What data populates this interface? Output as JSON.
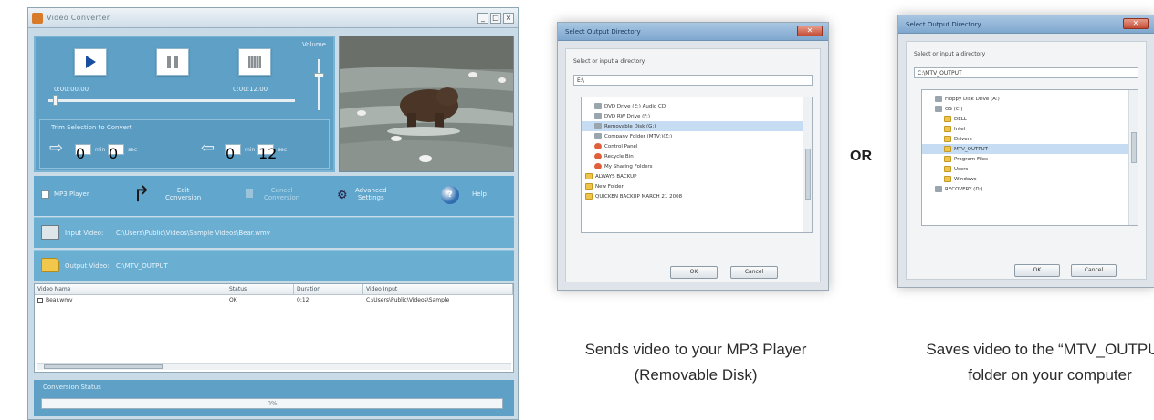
{
  "main_window": {
    "title": "Video Converter",
    "titlebar_buttons": [
      "_",
      "□",
      "×"
    ],
    "player": {
      "elapsed": "0:00:00.00",
      "duration": "0:00:12.00",
      "volume_label": "Volume",
      "volume_level": 0.7,
      "seek_position": 0.02,
      "trim_title": "Trim Selection to Convert",
      "trim_start": {
        "min": "0",
        "min_unit": "min",
        "sec": "0",
        "sec_unit": "sec"
      },
      "trim_end": {
        "min": "0",
        "min_unit": "min",
        "sec": "12",
        "sec_unit": "sec"
      }
    },
    "options": {
      "mp3_player_label": "MP3 Player",
      "edit_label": "Edit\nConversion",
      "cancel_label": "Cancel\nConversion",
      "settings_label": "Advanced\nSettings",
      "help_glyph": "?",
      "help_label": "Help"
    },
    "input_video": {
      "label": "Input Video:",
      "path": "C:\\Users\\Public\\Videos\\Sample Videos\\Bear.wmv"
    },
    "output_video": {
      "label": "Output Video:",
      "path": "C:\\MTV_OUTPUT"
    },
    "table": {
      "columns": [
        "Video Name",
        "Status",
        "Duration",
        "Video Input"
      ],
      "rows": [
        {
          "name": "Bear.wmv",
          "status": "OK",
          "duration": "0:12",
          "input": "C:\\Users\\Public\\Videos\\Sample"
        }
      ]
    },
    "status": {
      "label": "Conversion Status",
      "progress_text": "0%"
    }
  },
  "dialog_1": {
    "title": "Select Output Directory",
    "prompt": "Select or input a directory",
    "path_value": "E:\\",
    "tree": [
      {
        "label": "DVD Drive (E:) Audio CD",
        "icon": "drive",
        "indent": 1
      },
      {
        "label": "DVD RW Drive (F:)",
        "icon": "drive",
        "indent": 1
      },
      {
        "label": "Removable Disk (G:)",
        "icon": "drive",
        "indent": 1,
        "selected": true
      },
      {
        "label": "Company Folder (MTV:)(Z:)",
        "icon": "drive",
        "indent": 1
      },
      {
        "label": "Control Panel",
        "icon": "special",
        "indent": 1
      },
      {
        "label": "Recycle Bin",
        "icon": "special",
        "indent": 1
      },
      {
        "label": "My Sharing Folders",
        "icon": "special",
        "indent": 1
      },
      {
        "label": "ALWAYS BACKUP",
        "icon": "folder",
        "indent": 0
      },
      {
        "label": "New Folder",
        "icon": "folder",
        "indent": 0
      },
      {
        "label": "QUICKEN BACKUP MARCH 21 2008",
        "icon": "folder",
        "indent": 0
      }
    ],
    "ok_label": "OK",
    "cancel_label": "Cancel"
  },
  "dialog_2": {
    "title": "Select Output Directory",
    "prompt": "Select or input a directory",
    "path_value": "C:\\MTV_OUTPUT",
    "tree": [
      {
        "label": "Floppy Disk Drive (A:)",
        "icon": "drive",
        "indent": 1
      },
      {
        "label": "OS (C:)",
        "icon": "drive",
        "indent": 1
      },
      {
        "label": "DELL",
        "icon": "folder",
        "indent": 2
      },
      {
        "label": "Intel",
        "icon": "folder",
        "indent": 2
      },
      {
        "label": "Drivers",
        "icon": "folder",
        "indent": 2
      },
      {
        "label": "MTV_OUTPUT",
        "icon": "folder",
        "indent": 2,
        "selected": true
      },
      {
        "label": "Program Files",
        "icon": "folder",
        "indent": 2
      },
      {
        "label": "Users",
        "icon": "folder",
        "indent": 2
      },
      {
        "label": "Windows",
        "icon": "folder",
        "indent": 2
      },
      {
        "label": "RECOVERY (D:)",
        "icon": "drive",
        "indent": 1
      }
    ],
    "ok_label": "OK",
    "cancel_label": "Cancel"
  },
  "or_text": "OR",
  "caption_1": [
    "Sends video to your MP3 Player",
    "(Removable Disk)"
  ],
  "caption_2": [
    "Saves video to the “MTV_OUTPUT”",
    "folder on your computer"
  ]
}
